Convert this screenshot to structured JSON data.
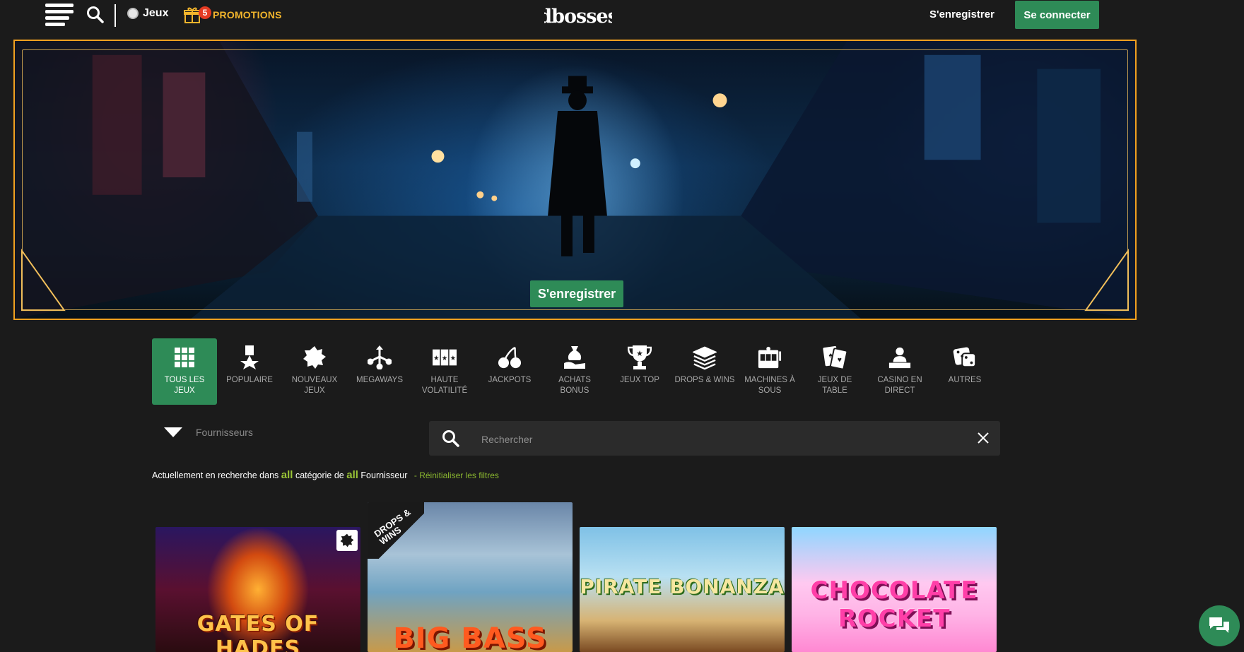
{
  "header": {
    "jeux_label": "Jeux",
    "promo_badge": "5",
    "promo_label": "PROMOTIONS",
    "logo_text": "dbosses",
    "register_label": "S'enregistrer",
    "login_label": "Se connecter"
  },
  "hero": {
    "cta_label": "S'enregistrer"
  },
  "categories": [
    {
      "label": "TOUS LES JEUX",
      "icon": "grid-icon",
      "active": true
    },
    {
      "label": "POPULAIRE",
      "icon": "medal-icon"
    },
    {
      "label": "NOUVEAUX JEUX",
      "icon": "new-badge-icon"
    },
    {
      "label": "MEGAWAYS",
      "icon": "megaways-icon"
    },
    {
      "label": "HAUTE VOLATILITÉ",
      "icon": "volatility-icon"
    },
    {
      "label": "JACKPOTS",
      "icon": "cherries-icon"
    },
    {
      "label": "ACHATS BONUS",
      "icon": "bonus-buy-icon"
    },
    {
      "label": "JEUX TOP",
      "icon": "trophy-icon"
    },
    {
      "label": "DROPS & WINS",
      "icon": "cash-stack-icon"
    },
    {
      "label": "MACHINES À SOUS",
      "icon": "slot-machine-icon"
    },
    {
      "label": "JEUX DE TABLE",
      "icon": "cards-icon"
    },
    {
      "label": "CASINO EN DIRECT",
      "icon": "dealer-icon"
    },
    {
      "label": "AUTRES",
      "icon": "dice-icon"
    }
  ],
  "filters": {
    "providers_label": "Fournisseurs",
    "search_placeholder": "Rechercher",
    "search_value": "",
    "status_prefix": "Actuellement en recherche dans",
    "status_all_1": "all",
    "status_mid": "catégorie de",
    "status_all_2": "all",
    "status_suffix": "Fournisseur",
    "reset_label": "- Réinitialiser les filtres"
  },
  "games": [
    {
      "title": "GATES OF HADES"
    },
    {
      "title": "BIG BASS",
      "tag": "DROPS & WINS"
    },
    {
      "title": "PIRATE BONANZA"
    },
    {
      "title": "CHOCOLATE ROCKET"
    }
  ],
  "colors": {
    "accent_green": "#2e8b57",
    "promo_gold": "#f2b52c",
    "badge_red": "#e53b23",
    "hero_border": "#f0a020",
    "highlight_lime": "#9ac536",
    "background": "#1b1b1b"
  }
}
